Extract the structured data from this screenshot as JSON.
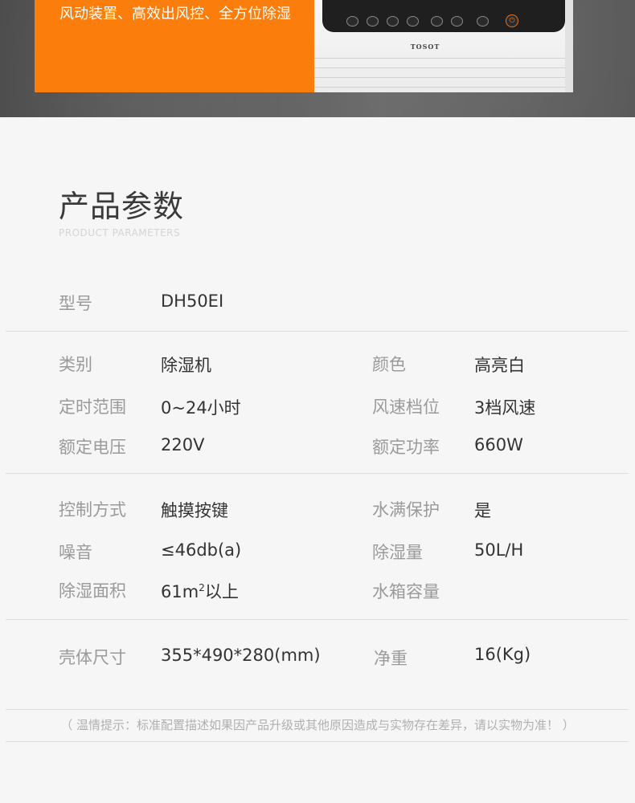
{
  "banner": {
    "feature_text": "风动装置、高效出风控、全方位除湿",
    "brand_logo": "TOSOT",
    "colors": {
      "accent": "#fb7d0c"
    }
  },
  "section": {
    "title": "产品参数",
    "subtitle": "PRODUCT PARAMETERS"
  },
  "specs": {
    "model_label": "型号",
    "model_value": "DH50EI",
    "type_label": "类别",
    "type_value": "除湿机",
    "color_label": "颜色",
    "color_value": "高亮白",
    "timer_label": "定时范围",
    "timer_value": "0~24小时",
    "fan_label": "风速档位",
    "fan_value": "3档风速",
    "voltage_label": "额定电压",
    "voltage_value": "220V",
    "power_label": "额定功率",
    "power_value": "660W",
    "control_label": "控制方式",
    "control_value": "触摸按键",
    "fullwater_label": "水满保护",
    "fullwater_value": "是",
    "noise_label": "噪音",
    "noise_value": "≤46db(a)",
    "dehumid_label": "除湿量",
    "dehumid_value": "50L/H",
    "area_label": "除湿面积",
    "area_value_main": "61m",
    "area_value_sup": "2",
    "area_value_tail": "以上",
    "tank_label": "水箱容量",
    "tank_value": "",
    "size_label": "壳体尺寸",
    "size_value": "355*490*280(mm)",
    "weight_label": "净重",
    "weight_value": "16(Kg)"
  },
  "note": "（ 温情提示：标准配置描述如果因产品升级或其他原因造成与实物存在差异，请以实物为准！ ）"
}
